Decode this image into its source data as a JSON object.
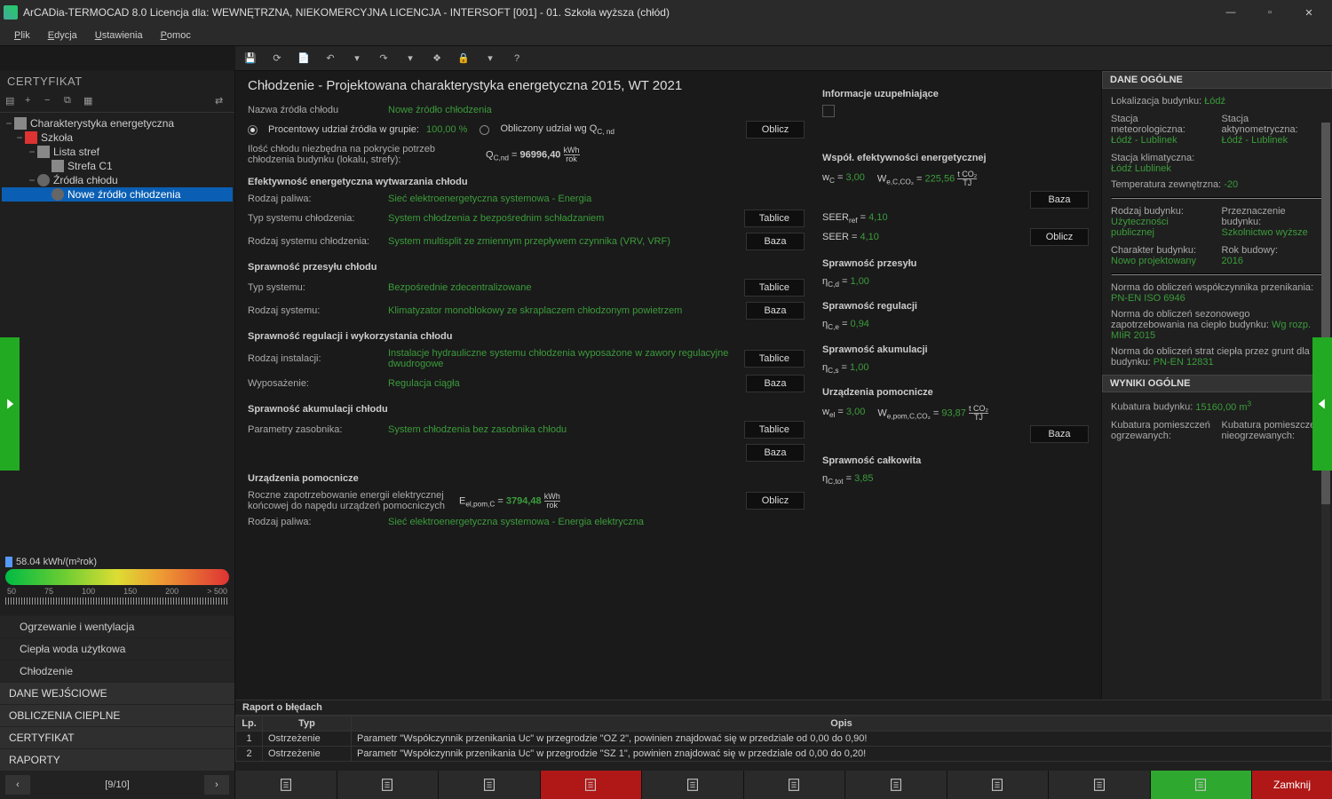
{
  "title": "ArCADia-TERMOCAD 8.0 Licencja dla: WEWNĘTRZNA, NIEKOMERCYJNA LICENCJA - INTERSOFT [001] - 01. Szkoła wyższa (chłód)",
  "menu": {
    "plik": "Plik",
    "edycja": "Edycja",
    "ustawienia": "Ustawienia",
    "pomoc": "Pomoc"
  },
  "cert_header": "CERTYFIKAT",
  "tree": {
    "root": "Charakterystyka energetyczna",
    "szkola": "Szkoła",
    "lista": "Lista stref",
    "strefa": "Strefa C1",
    "zrodla": "Źródła chłodu",
    "nowe": "Nowe źródło chłodzenia"
  },
  "gauge": {
    "value": "58.04 kWh/(m²rok)",
    "ticks": [
      "50",
      "75",
      "100",
      "150",
      "200",
      "> 500"
    ]
  },
  "nav": {
    "ogrz": "Ogrzewanie i wentylacja",
    "cwu": "Ciepła woda użytkowa",
    "chlod": "Chłodzenie",
    "dane": "DANE WEJŚCIOWE",
    "obl": "OBLICZENIA CIEPLNE",
    "cert": "CERTYFIKAT",
    "rap": "RAPORTY"
  },
  "page_title": "Chłodzenie - Projektowana charakterystyka energetyczna 2015, WT 2021",
  "labels": {
    "nazwa": "Nazwa źródła chłodu",
    "nazwa_v": "Nowe źródło chłodzenia",
    "percent": "Procentowy udział źródła w grupie:",
    "percent_v": "100,00 %",
    "obliczony": "Obliczony udział wg Q",
    "ilosc": "Ilość chłodu niezbędna na pokrycie potrzeb chłodzenia budynku (lokalu, strefy):",
    "q_val": "Q_C,nd = 96996,40",
    "efekt_hd": "Efektywność energetyczna wytwarzania chłodu",
    "rodzaj_paliwa": "Rodzaj paliwa:",
    "rodzaj_paliwa_v": "Sieć elektroenergetyczna systemowa - Energia",
    "typ_sys": "Typ systemu chłodzenia:",
    "typ_sys_v": "System chłodzenia z bezpośrednim schładzaniem",
    "rodzaj_sys": "Rodzaj systemu chłodzenia:",
    "rodzaj_sys_v": "System multisplit ze zmiennym przepływem czynnika (VRV, VRF)",
    "przesyl_hd": "Sprawność przesyłu chłodu",
    "typ_sys2": "Typ systemu:",
    "typ_sys2_v": "Bezpośrednie zdecentralizowane",
    "rodzaj_sys2": "Rodzaj systemu:",
    "rodzaj_sys2_v": "Klimatyzator monoblokowy ze skraplaczem chłodzonym powietrzem",
    "reg_hd": "Sprawność regulacji i wykorzystania chłodu",
    "rodzaj_inst": "Rodzaj instalacji:",
    "rodzaj_inst_v": "Instalacje hydrauliczne systemu chłodzenia wyposażone w zawory regulacyjne dwudrogowe",
    "wyposaz": "Wyposażenie:",
    "wyposaz_v": "Regulacja ciągła",
    "akum_hd": "Sprawność akumulacji chłodu",
    "param_zas": "Parametry zasobnika:",
    "param_zas_v": "System chłodzenia bez zasobnika chłodu",
    "pomoc_hd": "Urządzenia pomocnicze",
    "roczne": "Roczne zapotrzebowanie energii elektrycznej końcowej do napędu urządzeń pomocniczych",
    "e_val": "E_el,pom,C = 3794,48",
    "rodzaj_paliwa2_v": "Sieć elektroenergetyczna systemowa - Energia elektryczna",
    "info_uzup": "Informacje uzupełniające",
    "wspol_hd": "Współ. efektywności energetycznej",
    "wc": "w_C = 3,00",
    "wco2": "W_e,C,CO₂ = 225,56",
    "seer_ref": "SEER_ref = 4,10",
    "seer": "SEER = 4,10",
    "spraw_przes": "Sprawność przesyłu",
    "ncd": "η_C,d = 1,00",
    "spraw_reg": "Sprawność regulacji",
    "nce": "η_C,e = 0,94",
    "spraw_akum": "Sprawność akumulacji",
    "ncs": "η_C,s = 1,00",
    "urz_pom": "Urządzenia pomocnicze",
    "wel": "w_el = 3,00",
    "weco2": "W_e,pom,C,CO₂ = 93,87",
    "spraw_calk": "Sprawność całkowita",
    "nctot": "η_C,tot = 3,85",
    "oblicz": "Oblicz",
    "tablice": "Tablice",
    "baza": "Baza"
  },
  "right": {
    "hd1": "DANE OGÓLNE",
    "lok_k": "Lokalizacja budynku:",
    "lok_v": "Łódź",
    "stm_k": "Stacja meteorologiczna:",
    "stm_v": "Łódź - Lublinek",
    "sta_k": "Stacja aktynometryczna:",
    "sta_v": "Łódź - Lublinek",
    "stk_k": "Stacja klimatyczna:",
    "stk_v": "Łódź Lublinek",
    "temp_k": "Temperatura zewnętrzna:",
    "temp_v": "-20",
    "rodz_k": "Rodzaj budynku:",
    "rodz_v": "Użyteczności publicznej",
    "przez_k": "Przeznaczenie budynku:",
    "przez_v": "Szkolnictwo wyższe",
    "char_k": "Charakter budynku:",
    "char_v": "Nowo projektowany",
    "rok_k": "Rok budowy:",
    "rok_v": "2016",
    "norm1_k": "Norma do obliczeń współczynnika przenikania:",
    "norm1_v": "PN-EN ISO 6946",
    "norm2_k": "Norma do obliczeń sezonowego zapotrzebowania na ciepło budynku:",
    "norm2_v": "Wg rozp. MIiR 2015",
    "norm3_k": "Norma do obliczeń strat ciepła przez grunt dla budynku:",
    "norm3_v": "PN-EN 12831",
    "hd2": "WYNIKI OGÓLNE",
    "kub_k": "Kubatura budynku:",
    "kub_v": "15160,00 m³",
    "kubo_k": "Kubatura pomieszczeń ogrzewanych:",
    "kubn_k": "Kubatura pomieszczeń nieogrzewanych:"
  },
  "errors": {
    "hd": "Raport o błędach",
    "cols": {
      "lp": "Lp.",
      "typ": "Typ",
      "opis": "Opis"
    },
    "rows": [
      {
        "lp": "1",
        "typ": "Ostrzeżenie",
        "opis": "Parametr \"Współczynnik przenikania Uc\" w przegrodzie \"OZ 2\", powinien znajdować się w przedziale od 0,00 do 0,90!"
      },
      {
        "lp": "2",
        "typ": "Ostrzeżenie",
        "opis": "Parametr \"Współczynnik przenikania Uc\" w przegrodzie \"SZ 1\", powinien znajdować się w przedziale od 0,00 do 0,20!"
      }
    ]
  },
  "pager": "[9/10]",
  "close": "Zamknij",
  "tab_colors": [
    "#2a2a2a",
    "#2a2a2a",
    "#2a2a2a",
    "#b01818",
    "#2a2a2a",
    "#2a2a2a",
    "#2a2a2a",
    "#2a2a2a",
    "#2a2a2a",
    "#2fa82f"
  ]
}
